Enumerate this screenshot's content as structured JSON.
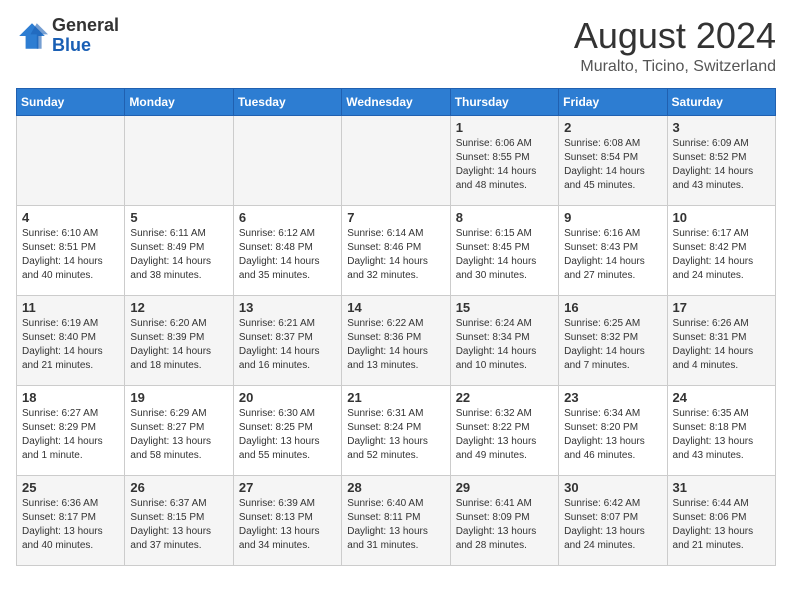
{
  "logo": {
    "text_general": "General",
    "text_blue": "Blue"
  },
  "header": {
    "title": "August 2024",
    "subtitle": "Muralto, Ticino, Switzerland"
  },
  "days_of_week": [
    "Sunday",
    "Monday",
    "Tuesday",
    "Wednesday",
    "Thursday",
    "Friday",
    "Saturday"
  ],
  "weeks": [
    [
      {
        "day": "",
        "detail": ""
      },
      {
        "day": "",
        "detail": ""
      },
      {
        "day": "",
        "detail": ""
      },
      {
        "day": "",
        "detail": ""
      },
      {
        "day": "1",
        "detail": "Sunrise: 6:06 AM\nSunset: 8:55 PM\nDaylight: 14 hours\nand 48 minutes."
      },
      {
        "day": "2",
        "detail": "Sunrise: 6:08 AM\nSunset: 8:54 PM\nDaylight: 14 hours\nand 45 minutes."
      },
      {
        "day": "3",
        "detail": "Sunrise: 6:09 AM\nSunset: 8:52 PM\nDaylight: 14 hours\nand 43 minutes."
      }
    ],
    [
      {
        "day": "4",
        "detail": "Sunrise: 6:10 AM\nSunset: 8:51 PM\nDaylight: 14 hours\nand 40 minutes."
      },
      {
        "day": "5",
        "detail": "Sunrise: 6:11 AM\nSunset: 8:49 PM\nDaylight: 14 hours\nand 38 minutes."
      },
      {
        "day": "6",
        "detail": "Sunrise: 6:12 AM\nSunset: 8:48 PM\nDaylight: 14 hours\nand 35 minutes."
      },
      {
        "day": "7",
        "detail": "Sunrise: 6:14 AM\nSunset: 8:46 PM\nDaylight: 14 hours\nand 32 minutes."
      },
      {
        "day": "8",
        "detail": "Sunrise: 6:15 AM\nSunset: 8:45 PM\nDaylight: 14 hours\nand 30 minutes."
      },
      {
        "day": "9",
        "detail": "Sunrise: 6:16 AM\nSunset: 8:43 PM\nDaylight: 14 hours\nand 27 minutes."
      },
      {
        "day": "10",
        "detail": "Sunrise: 6:17 AM\nSunset: 8:42 PM\nDaylight: 14 hours\nand 24 minutes."
      }
    ],
    [
      {
        "day": "11",
        "detail": "Sunrise: 6:19 AM\nSunset: 8:40 PM\nDaylight: 14 hours\nand 21 minutes."
      },
      {
        "day": "12",
        "detail": "Sunrise: 6:20 AM\nSunset: 8:39 PM\nDaylight: 14 hours\nand 18 minutes."
      },
      {
        "day": "13",
        "detail": "Sunrise: 6:21 AM\nSunset: 8:37 PM\nDaylight: 14 hours\nand 16 minutes."
      },
      {
        "day": "14",
        "detail": "Sunrise: 6:22 AM\nSunset: 8:36 PM\nDaylight: 14 hours\nand 13 minutes."
      },
      {
        "day": "15",
        "detail": "Sunrise: 6:24 AM\nSunset: 8:34 PM\nDaylight: 14 hours\nand 10 minutes."
      },
      {
        "day": "16",
        "detail": "Sunrise: 6:25 AM\nSunset: 8:32 PM\nDaylight: 14 hours\nand 7 minutes."
      },
      {
        "day": "17",
        "detail": "Sunrise: 6:26 AM\nSunset: 8:31 PM\nDaylight: 14 hours\nand 4 minutes."
      }
    ],
    [
      {
        "day": "18",
        "detail": "Sunrise: 6:27 AM\nSunset: 8:29 PM\nDaylight: 14 hours\nand 1 minute."
      },
      {
        "day": "19",
        "detail": "Sunrise: 6:29 AM\nSunset: 8:27 PM\nDaylight: 13 hours\nand 58 minutes."
      },
      {
        "day": "20",
        "detail": "Sunrise: 6:30 AM\nSunset: 8:25 PM\nDaylight: 13 hours\nand 55 minutes."
      },
      {
        "day": "21",
        "detail": "Sunrise: 6:31 AM\nSunset: 8:24 PM\nDaylight: 13 hours\nand 52 minutes."
      },
      {
        "day": "22",
        "detail": "Sunrise: 6:32 AM\nSunset: 8:22 PM\nDaylight: 13 hours\nand 49 minutes."
      },
      {
        "day": "23",
        "detail": "Sunrise: 6:34 AM\nSunset: 8:20 PM\nDaylight: 13 hours\nand 46 minutes."
      },
      {
        "day": "24",
        "detail": "Sunrise: 6:35 AM\nSunset: 8:18 PM\nDaylight: 13 hours\nand 43 minutes."
      }
    ],
    [
      {
        "day": "25",
        "detail": "Sunrise: 6:36 AM\nSunset: 8:17 PM\nDaylight: 13 hours\nand 40 minutes."
      },
      {
        "day": "26",
        "detail": "Sunrise: 6:37 AM\nSunset: 8:15 PM\nDaylight: 13 hours\nand 37 minutes."
      },
      {
        "day": "27",
        "detail": "Sunrise: 6:39 AM\nSunset: 8:13 PM\nDaylight: 13 hours\nand 34 minutes."
      },
      {
        "day": "28",
        "detail": "Sunrise: 6:40 AM\nSunset: 8:11 PM\nDaylight: 13 hours\nand 31 minutes."
      },
      {
        "day": "29",
        "detail": "Sunrise: 6:41 AM\nSunset: 8:09 PM\nDaylight: 13 hours\nand 28 minutes."
      },
      {
        "day": "30",
        "detail": "Sunrise: 6:42 AM\nSunset: 8:07 PM\nDaylight: 13 hours\nand 24 minutes."
      },
      {
        "day": "31",
        "detail": "Sunrise: 6:44 AM\nSunset: 8:06 PM\nDaylight: 13 hours\nand 21 minutes."
      }
    ]
  ]
}
